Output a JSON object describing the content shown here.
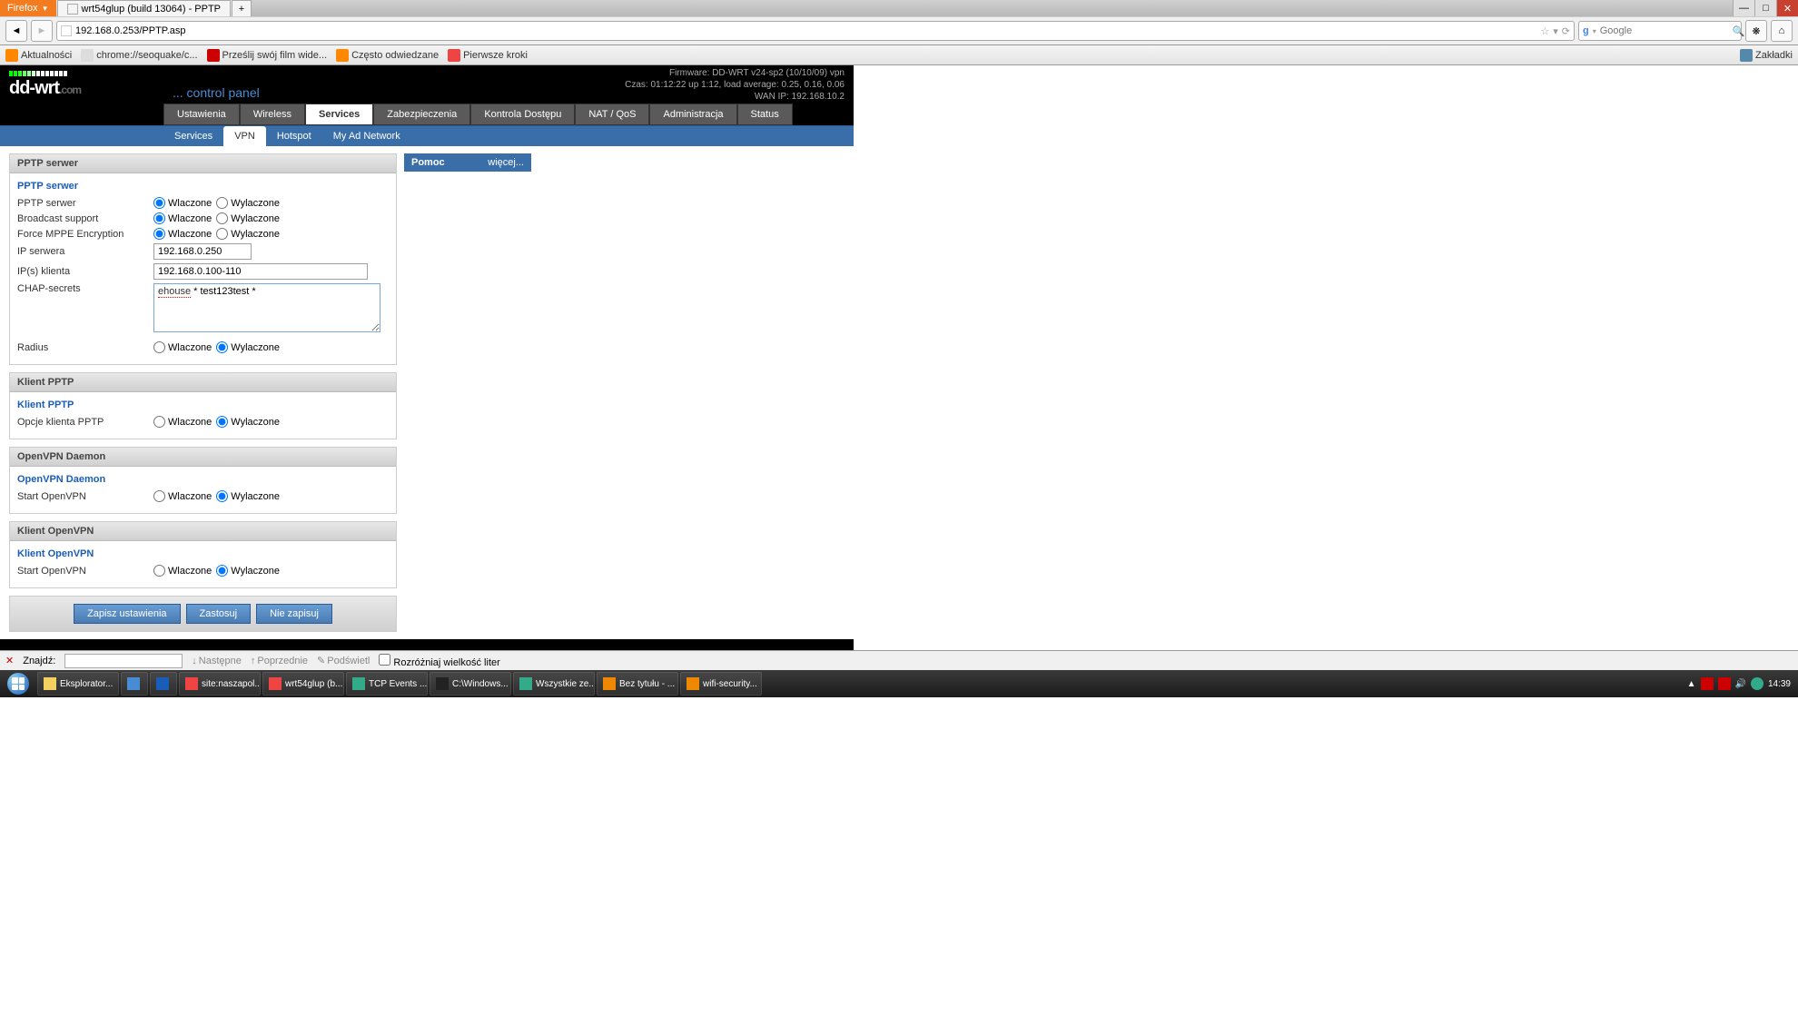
{
  "browser": {
    "name": "Firefox",
    "tab_title": "wrt54glup (build 13064) - PPTP",
    "url": "192.168.0.253/PPTP.asp",
    "search_placeholder": "Google",
    "bookmarks": [
      "Aktualności",
      "chrome://seoquake/c...",
      "Prześlij swój film wide...",
      "Często odwiedzane",
      "Pierwsze kroki"
    ],
    "bookmarks_label": "Zakładki"
  },
  "ddwrt": {
    "logo": "dd-wrt",
    "logo_suffix": ".com",
    "subtitle": "... control panel",
    "info_firmware": "Firmware: DD-WRT v24-sp2 (10/10/09) vpn",
    "info_czas": "Czas: 01:12:22 up 1:12, load average: 0.25, 0.16, 0.06",
    "info_wan": "WAN IP: 192.168.10.2",
    "tabs": [
      "Ustawienia",
      "Wireless",
      "Services",
      "Zabezpieczenia",
      "Kontrola Dostępu",
      "NAT / QoS",
      "Administracja",
      "Status"
    ],
    "subtabs": [
      "Services",
      "VPN",
      "Hotspot",
      "My Ad Network"
    ],
    "help_title": "Pomoc",
    "help_more": "więcej..."
  },
  "labels": {
    "wlaczone": "Wlaczone",
    "wylaczone": "Wylaczone"
  },
  "pptp_server": {
    "panel_title": "PPTP serwer",
    "section_title": "PPTP serwer",
    "fields": {
      "server": "PPTP serwer",
      "broadcast": "Broadcast support",
      "mppe": "Force MPPE Encryption",
      "serverip": "IP serwera",
      "clientip": "IP(s) klienta",
      "chap": "CHAP-secrets",
      "radius": "Radius"
    },
    "serverip_val": "192.168.0.250",
    "clientip_val": "192.168.0.100-110",
    "chap_val": "ehouse * test123test *",
    "chap_word1": "ehouse",
    "chap_rest": " * test123test *"
  },
  "pptp_client": {
    "panel_title": "Klient PPTP",
    "section_title": "Klient PPTP",
    "field": "Opcje klienta PPTP"
  },
  "openvpn_daemon": {
    "panel_title": "OpenVPN Daemon",
    "section_title": "OpenVPN Daemon",
    "field": "Start OpenVPN"
  },
  "openvpn_client": {
    "panel_title": "Klient OpenVPN",
    "section_title": "Klient OpenVPN",
    "field": "Start OpenVPN"
  },
  "buttons": {
    "save": "Zapisz ustawienia",
    "apply": "Zastosuj",
    "cancel": "Nie zapisuj"
  },
  "findbar": {
    "label": "Znajdź:",
    "next": "Następne",
    "prev": "Poprzednie",
    "highlight": "Podświetl",
    "matchcase": "Rozróżniaj wielkość liter"
  },
  "taskbar": {
    "items": [
      "Eksplorator...",
      "",
      "",
      "site:naszapol...",
      "wrt54glup (b...",
      "TCP Events ...",
      "C:\\Windows...",
      "Wszystkie ze...",
      "Bez tytułu - ...",
      "wifi-security..."
    ],
    "clock": "14:39"
  }
}
